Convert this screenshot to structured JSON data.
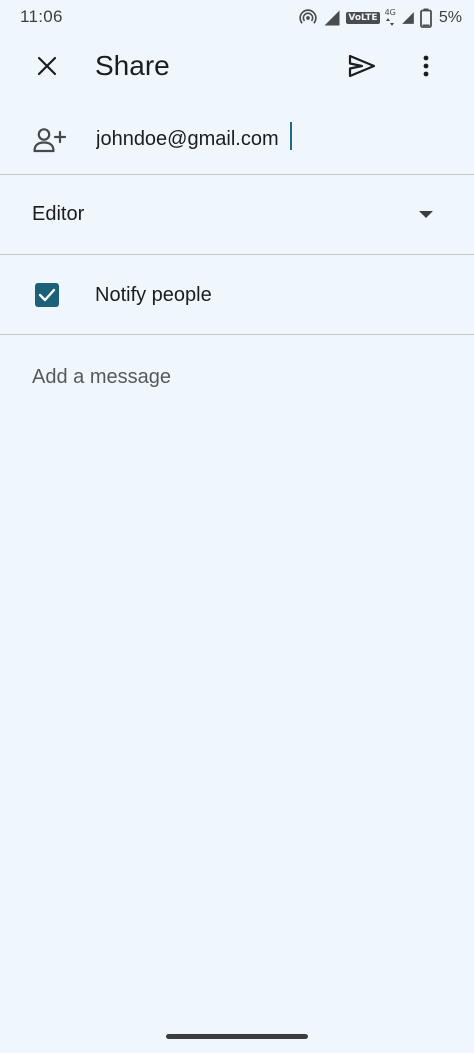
{
  "status_bar": {
    "time": "11:06",
    "volte": "VoLTE",
    "network": "4G",
    "battery_percent": "5%",
    "icons": [
      "hotspot-icon",
      "signal-icon",
      "volte-icon",
      "data-arrows-icon",
      "battery-icon"
    ]
  },
  "app_bar": {
    "title": "Share",
    "close_icon": "close-icon",
    "send_icon": "send-icon",
    "more_icon": "more-vert-icon"
  },
  "recipient": {
    "icon": "person-add-icon",
    "value": "johndoe@gmail.com"
  },
  "role": {
    "selected": "Editor",
    "icon": "dropdown-arrow-icon"
  },
  "notify": {
    "label": "Notify people",
    "checked": true
  },
  "message": {
    "placeholder": "Add a message"
  },
  "colors": {
    "background": "#f0f7fc",
    "accent": "#1c6079",
    "divider": "#c4c9cc"
  }
}
